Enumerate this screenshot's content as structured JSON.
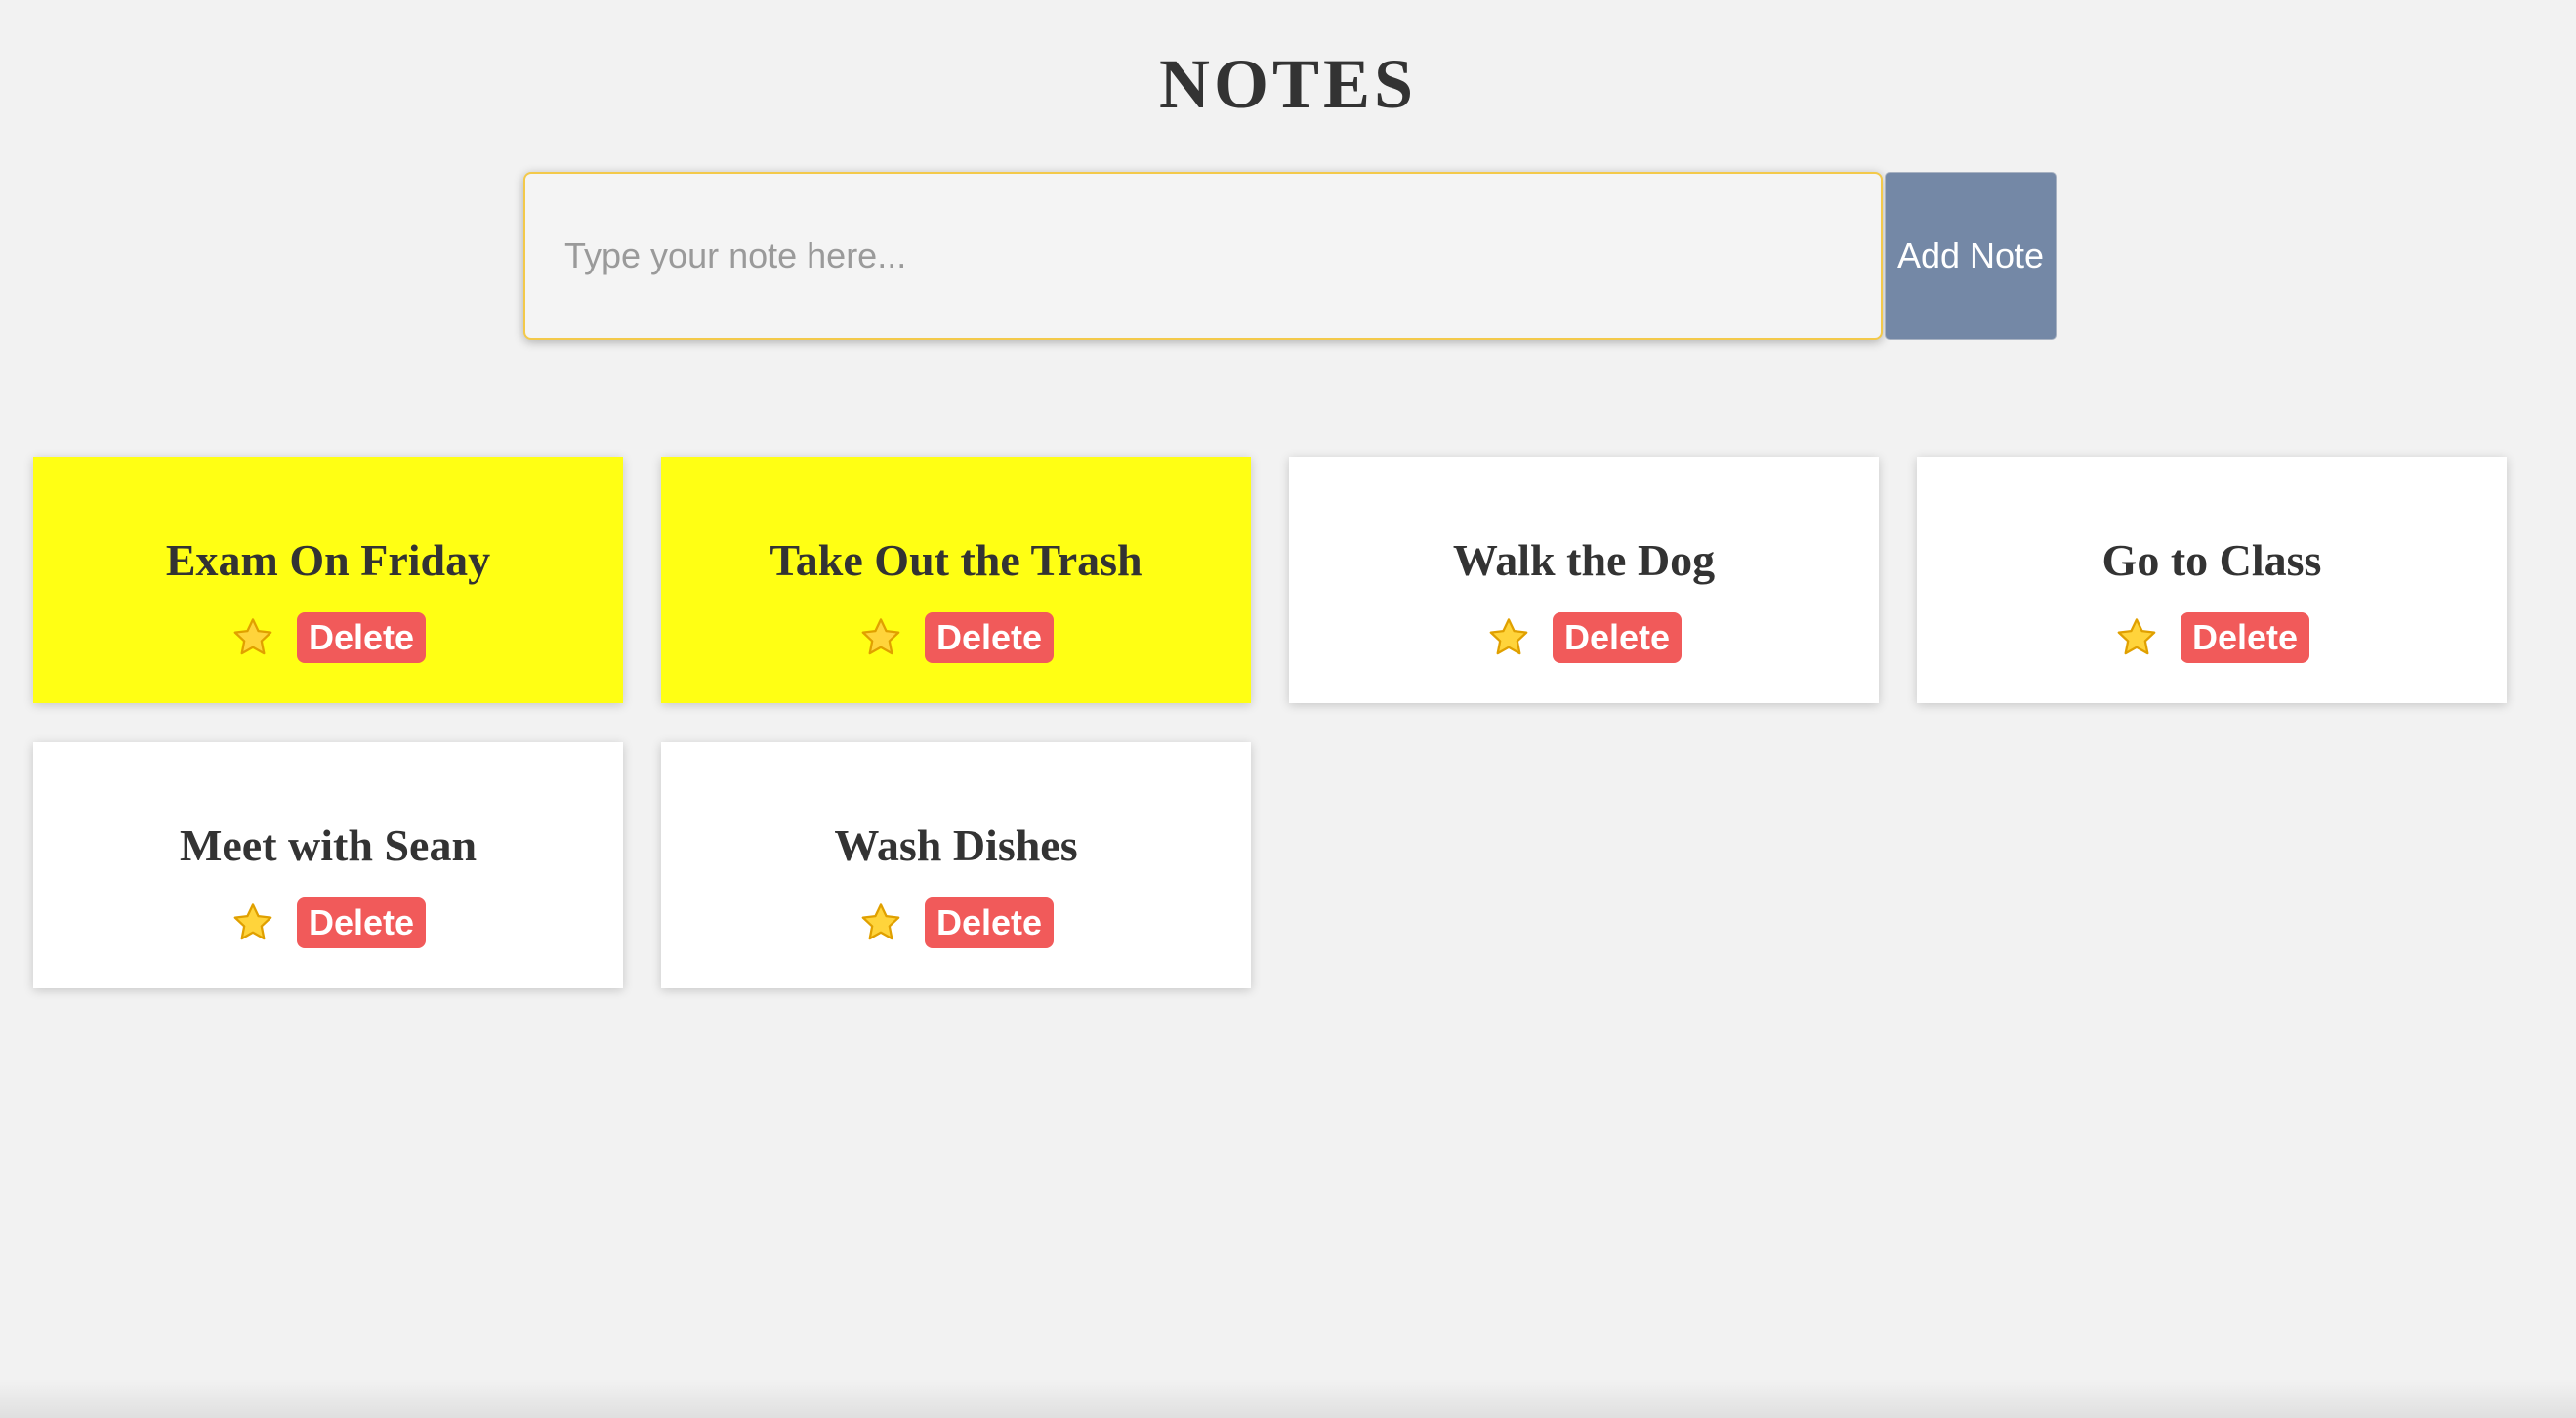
{
  "header": {
    "title": "NOTES"
  },
  "composer": {
    "placeholder": "Type your note here...",
    "value": "",
    "add_label": "Add Note"
  },
  "colors": {
    "starred_card": "#ffff14",
    "plain_card": "#ffffff",
    "delete_button": "#f15a5a",
    "add_button": "#7488a6",
    "input_border": "#f3c94a"
  },
  "notes": [
    {
      "title": "Exam On Friday",
      "starred": true,
      "star_icon": "star-icon",
      "delete_label": "Delete"
    },
    {
      "title": "Take Out the Trash",
      "starred": true,
      "star_icon": "star-icon",
      "delete_label": "Delete"
    },
    {
      "title": "Walk the Dog",
      "starred": false,
      "star_icon": "star-icon",
      "delete_label": "Delete"
    },
    {
      "title": "Go to Class",
      "starred": false,
      "star_icon": "star-icon",
      "delete_label": "Delete"
    },
    {
      "title": "Meet with Sean",
      "starred": false,
      "star_icon": "star-icon",
      "delete_label": "Delete"
    },
    {
      "title": "Wash Dishes",
      "starred": false,
      "star_icon": "star-icon",
      "delete_label": "Delete"
    }
  ]
}
